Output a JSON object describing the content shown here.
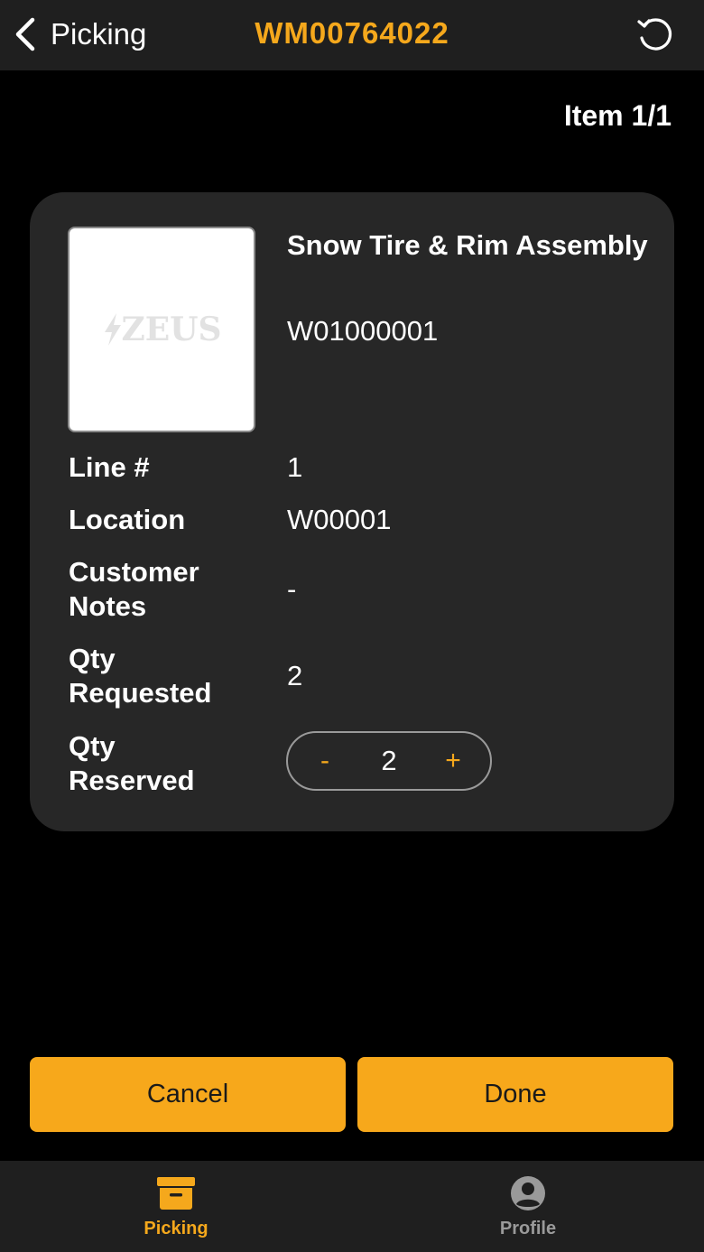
{
  "header": {
    "back_label": "Picking",
    "order_id": "WM00764022"
  },
  "item_count": "Item 1/1",
  "product": {
    "image_logo_text": "ZEUS",
    "name": "Snow Tire & Rim Assembly",
    "sku": "W01000001"
  },
  "details": {
    "line_label": "Line #",
    "line_value": "1",
    "location_label": "Location",
    "location_value": "W00001",
    "customer_notes_label_1": "Customer",
    "customer_notes_label_2": "Notes",
    "customer_notes_value": "-",
    "qty_requested_label_1": "Qty",
    "qty_requested_label_2": "Requested",
    "qty_requested_value": "2",
    "qty_reserved_label_1": "Qty",
    "qty_reserved_label_2": "Reserved"
  },
  "stepper": {
    "minus": "-",
    "value": "2",
    "plus": "+"
  },
  "actions": {
    "cancel": "Cancel",
    "done": "Done"
  },
  "tabs": [
    {
      "label": "Picking",
      "icon": "archive-box-icon",
      "active": true
    },
    {
      "label": "Profile",
      "icon": "user-circle-icon",
      "active": false
    }
  ],
  "colors": {
    "accent": "#f5a81c",
    "button": "#f7a81b",
    "card": "#272727",
    "bar": "#1f1f1f",
    "inactive": "#9a9a9a"
  }
}
